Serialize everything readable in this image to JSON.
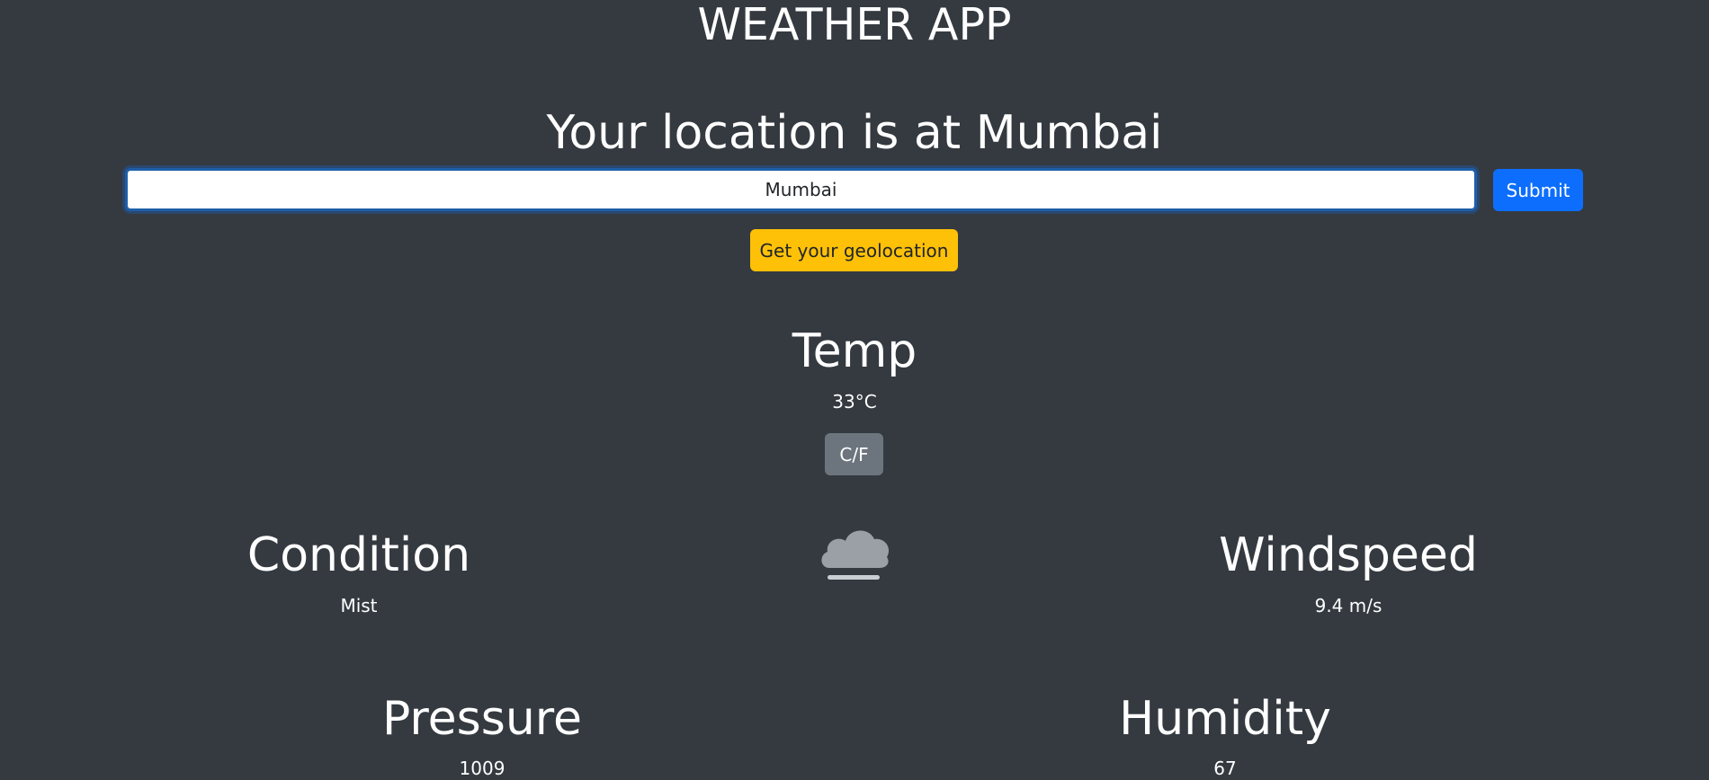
{
  "app": {
    "title": "WEATHER APP",
    "location_heading": "Your location is at Mumbai"
  },
  "search": {
    "value": "Mumbai",
    "submit_label": "Submit",
    "geolocation_label": "Get your geolocation"
  },
  "temperature": {
    "label": "Temp",
    "value": "33°C",
    "toggle_label": "C/F"
  },
  "condition": {
    "label": "Condition",
    "value": "Mist",
    "icon": "mist-cloud-icon"
  },
  "windspeed": {
    "label": "Windspeed",
    "value": "9.4 m/s"
  },
  "pressure": {
    "label": "Pressure",
    "value": "1009"
  },
  "humidity": {
    "label": "Humidity",
    "value": "67"
  },
  "colors": {
    "background": "#343a40",
    "primary": "#0d6efd",
    "warning": "#ffc107",
    "secondary": "#6c757d"
  }
}
